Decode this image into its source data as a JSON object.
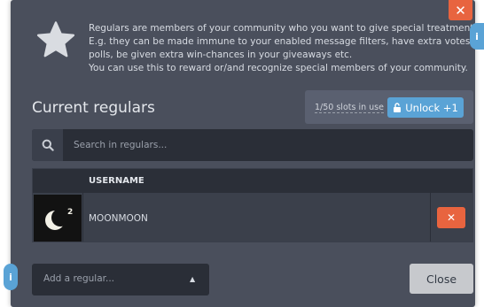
{
  "window": {
    "close_symbol": "✕"
  },
  "intro": {
    "lines": [
      "Regulars are members of your community who you want to give special treatment to.",
      "E.g. they can be made immune to your enabled message filters, have extra votes in your",
      "polls, be given extra win-chances in your giveaways etc.",
      "You can use this to reward or/and recognize special members of your community."
    ],
    "icon": "star-icon"
  },
  "section": {
    "title": "Current regulars"
  },
  "slots": {
    "text": "1/50 slots in use",
    "unlock_label": "Unlock +1",
    "unlock_icon": "lock-icon"
  },
  "search": {
    "placeholder": "Search in regulars...",
    "value": "",
    "icon": "search-icon"
  },
  "table": {
    "columns": [
      "",
      "USERNAME",
      ""
    ],
    "rows": [
      {
        "username": "MOONMOON",
        "avatar": "moon-avatar",
        "action": "✕"
      }
    ]
  },
  "footer": {
    "add_placeholder": "Add a regular...",
    "caret": "▲",
    "close_label": "Close"
  },
  "info": {
    "symbol": "i"
  },
  "colors": {
    "modal_bg": "#4a4f5c",
    "accent_orange": "#e8643f",
    "accent_blue": "#5aa3d6",
    "dark_input": "#2a2e37"
  }
}
